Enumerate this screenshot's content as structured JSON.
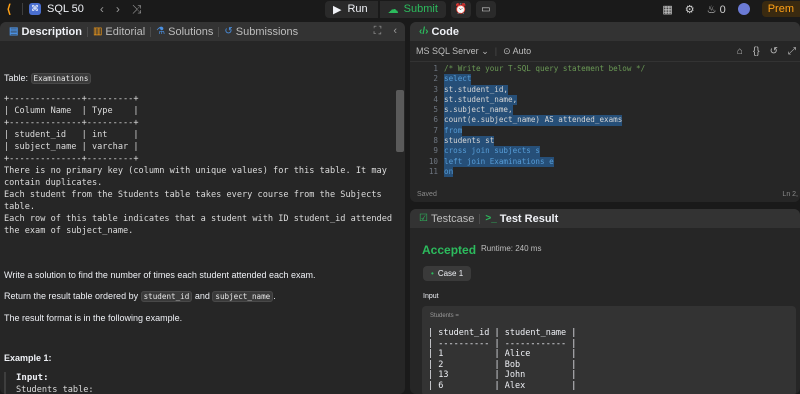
{
  "topbar": {
    "problem_list_label": "SQL 50",
    "run_label": "Run",
    "submit_label": "Submit",
    "coins": "0",
    "premium_label": "Prem"
  },
  "left_tabs": [
    "Description",
    "Editorial",
    "Solutions",
    "Submissions"
  ],
  "description": {
    "table_prefix": "Table:",
    "table_name": "Examinations",
    "schema_box": "+--------------+---------+\n| Column Name  | Type    |\n+--------------+---------+\n| student_id   | int     |\n| subject_name | varchar |\n+--------------+---------+",
    "notes": "There is no primary key (column with unique values) for this table. It may\ncontain duplicates.\nEach student from the Students table takes every course from the Subjects\ntable.\nEach row of this table indicates that a student with ID student_id attended\nthe exam of subject_name.",
    "task": "Write a solution to find the number of times each student attended each exam.",
    "order_prefix": "Return the result table ordered by",
    "order_col1": "student_id",
    "order_and": "and",
    "order_col2": "subject_name",
    "order_suffix": ".",
    "format_text": "The result format is in the following example.",
    "example_heading": "Example 1:",
    "input_label": "Input:",
    "students_table_label": "Students table:"
  },
  "code": {
    "tab_label": "Code",
    "language": "MS SQL Server",
    "auto_label": "Auto",
    "lines": [
      "/* Write your T-SQL query statement below */",
      "select",
      "st.student_id,",
      "st.student_name,",
      "s.subject_name,",
      "count(e.subject_name) AS attended_exams",
      "from",
      "students st",
      "cross join subjects s",
      "left join Examinations e",
      "on"
    ],
    "saved_label": "Saved",
    "cursor_label": "Ln 2,"
  },
  "result": {
    "testcase_tab": "Testcase",
    "result_tab": "Test Result",
    "status": "Accepted",
    "runtime": "Runtime: 240 ms",
    "case_label": "Case 1",
    "input_label": "Input",
    "students_label": "Students =",
    "students_table": "| student_id | student_name |\n| ---------- | ------------ |\n| 1          | Alice        |\n| 2          | Bob          |\n| 13         | John         |\n| 6          | Alex         |"
  },
  "colors": {
    "accent_green": "#2cbb5d",
    "accent_orange": "#ffa116",
    "panel_bg": "#262626",
    "selection": "#264f78"
  }
}
